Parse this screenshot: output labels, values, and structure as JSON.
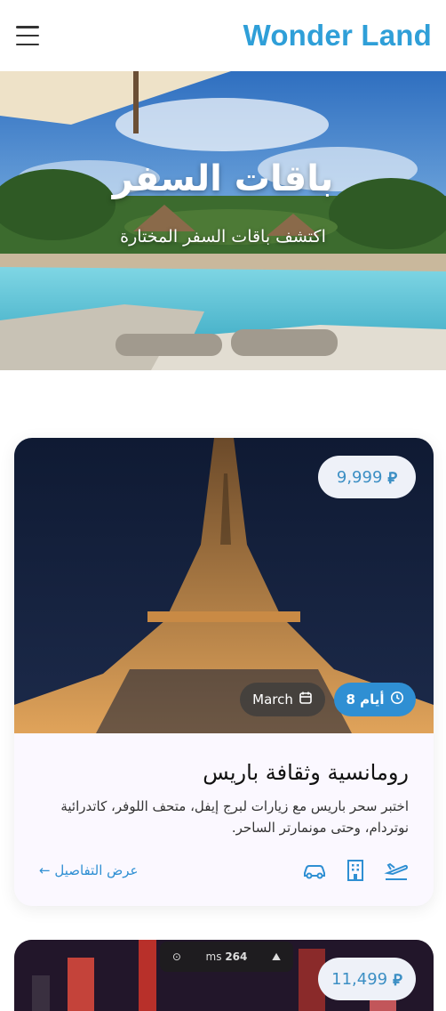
{
  "header": {
    "brand": "Wonder Land",
    "menu_icon": "hamburger-icon"
  },
  "hero": {
    "title": "باقات السفر",
    "subtitle": "اكتشف باقات السفر المختارة"
  },
  "cards": [
    {
      "price": "9,999",
      "currency_icon": "riyal-icon",
      "days": "8 أيام",
      "month": "March",
      "title": "رومانسية وثقافة باريس",
      "description": "اختبر سحر باريس مع زيارات لبرج إيفل، متحف اللوفر، كاتدرائية نوتردام، وحتى مونمارتر الساحر.",
      "details_label": "عرض التفاصيل ←",
      "amenities": [
        "plane-icon",
        "hotel-icon",
        "car-icon"
      ]
    },
    {
      "price": "11,499"
    }
  ],
  "overlay": {
    "ms": "264",
    "unit": "ms"
  },
  "colors": {
    "accent": "#2f9fd8",
    "badge_blue": "#2f8fd3"
  }
}
